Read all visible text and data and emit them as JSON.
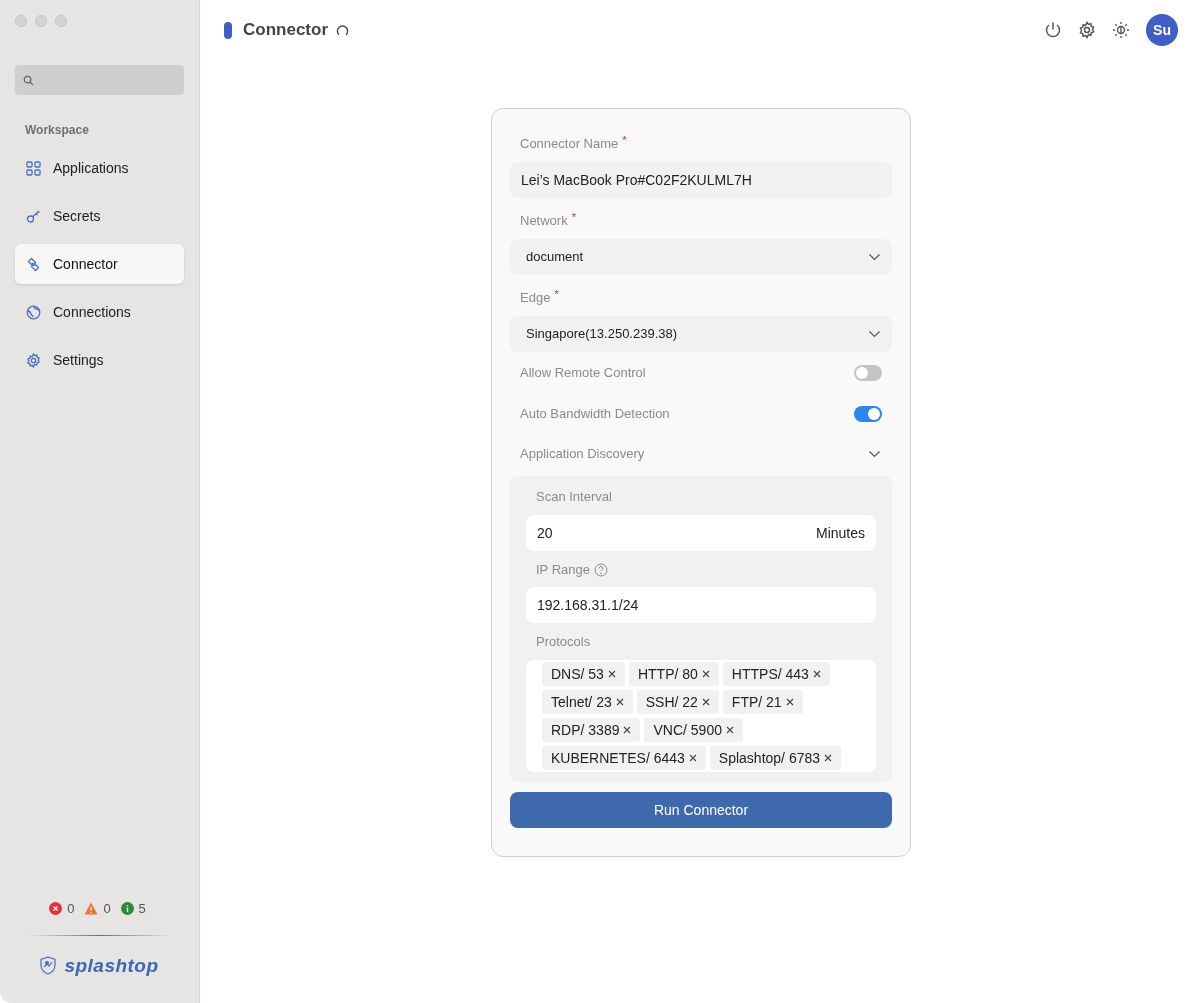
{
  "sidebar": {
    "section": "Workspace",
    "items": [
      {
        "label": "Applications",
        "selected": false
      },
      {
        "label": "Secrets",
        "selected": false
      },
      {
        "label": "Connector",
        "selected": true
      },
      {
        "label": "Connections",
        "selected": false
      },
      {
        "label": "Settings",
        "selected": false
      }
    ],
    "status": [
      {
        "kind": "error",
        "count": "0"
      },
      {
        "kind": "warning",
        "count": "0"
      },
      {
        "kind": "info",
        "count": "5"
      }
    ],
    "logo": "splashtop"
  },
  "header": {
    "title": "Connector",
    "avatar": "Su"
  },
  "form": {
    "connector_name": {
      "label": "Connector Name",
      "required_mark": "*",
      "value": "Lei’s MacBook Pro#C02F2KULML7H"
    },
    "network": {
      "label": "Network",
      "required_mark": "*",
      "value": "document"
    },
    "edge": {
      "label": "Edge",
      "required_mark": "*",
      "value": "Singapore(13.250.239.38)"
    },
    "toggles": [
      {
        "label": "Allow Remote Control",
        "on": false
      },
      {
        "label": "Auto Bandwidth Detection",
        "on": true
      }
    ],
    "discovery": {
      "label": "Application Discovery",
      "expanded": true,
      "scan_interval": {
        "label": "Scan Interval",
        "value": "20",
        "unit": "Minutes"
      },
      "ip_range": {
        "label": "IP Range",
        "value": "192.168.31.1/24"
      },
      "protocols": {
        "label": "Protocols",
        "tags": [
          "DNS/ 53",
          "HTTP/ 80",
          "HTTPS/ 443",
          "Telnet/ 23",
          "SSH/ 22",
          "FTP/ 21",
          "RDP/ 3389",
          "VNC/ 5900",
          "KUBERNETES/ 6443",
          "Splashtop/ 6783"
        ]
      }
    },
    "submit": "Run Connector"
  }
}
